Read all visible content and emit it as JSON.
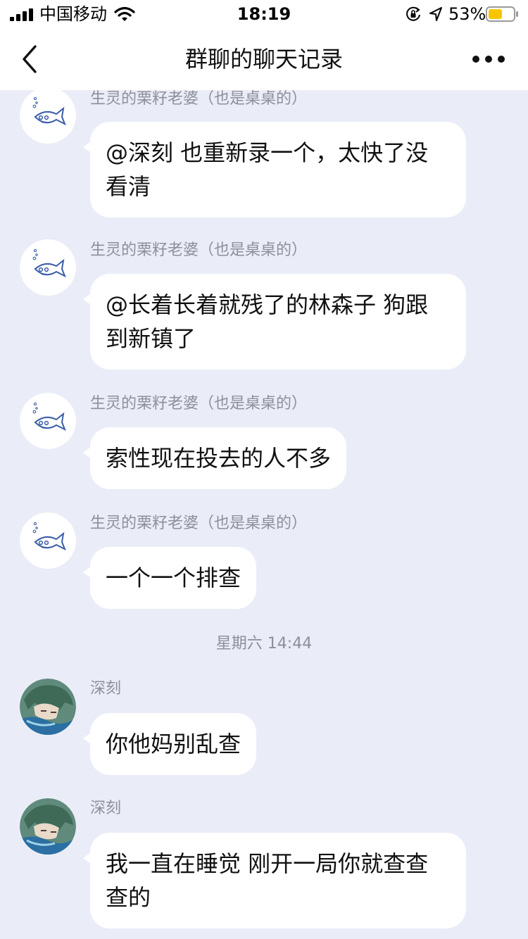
{
  "status_bar": {
    "carrier": "中国移动",
    "time": "18:19",
    "battery_percent": "53%",
    "icons": [
      "signal-icon",
      "wifi-icon",
      "rotation-lock-icon",
      "location-icon",
      "battery-icon"
    ]
  },
  "nav": {
    "title": "群聊的聊天记录",
    "back_icon": "chevron-left-icon",
    "more_icon": "more-dots-icon"
  },
  "messages": [
    {
      "sender": "生灵的栗籽老婆（也是桌桌的）",
      "text": "@深刻 也重新录一个，太快了没看清",
      "avatar": "fish-avatar"
    },
    {
      "sender": "生灵的栗籽老婆（也是桌桌的）",
      "text": "@长着长着就残了的林森子 狗跟到新镇了",
      "avatar": "fish-avatar"
    },
    {
      "sender": "生灵的栗籽老婆（也是桌桌的）",
      "text": "索性现在投去的人不多",
      "avatar": "fish-avatar"
    },
    {
      "sender": "生灵的栗籽老婆（也是桌桌的）",
      "text": "一个一个排查",
      "avatar": "fish-avatar"
    },
    {
      "sender": "深刻",
      "text": "你他妈别乱查",
      "avatar": "anime-avatar"
    },
    {
      "sender": "深刻",
      "text": "我一直在睡觉 刚开一局你就查查查的",
      "avatar": "anime-avatar"
    }
  ],
  "timestamp": "星期六 14:44",
  "colors": {
    "background": "#eaedf7",
    "bubble": "#ffffff",
    "meta_text": "#8d909c",
    "battery_fill": "#f7c600"
  }
}
